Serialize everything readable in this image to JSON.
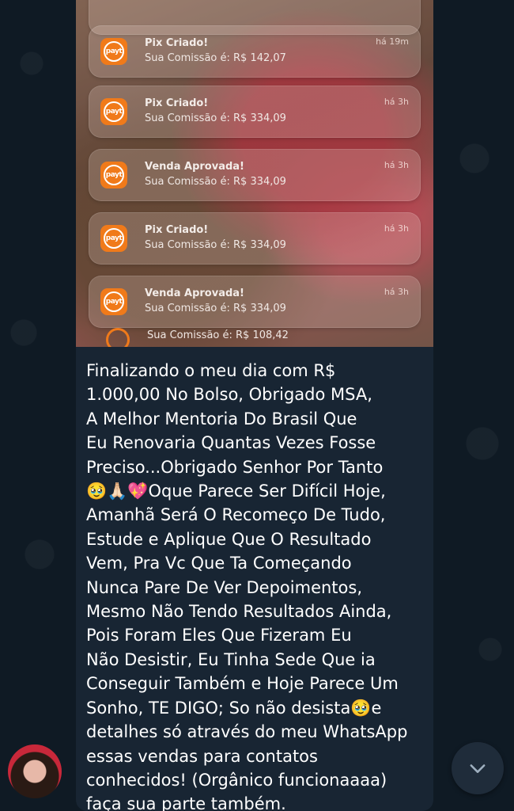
{
  "notifications": [
    {
      "title": "Pix Criado!",
      "body": "Sua Comissão é: R$ 142,07",
      "time": "há 19m"
    },
    {
      "title": "Pix Criado!",
      "body": "Sua Comissão é: R$ 334,09",
      "time": "há 3h"
    },
    {
      "title": "Venda Aprovada!",
      "body": "Sua Comissão é: R$ 334,09",
      "time": "há 3h"
    },
    {
      "title": "Pix Criado!",
      "body": "Sua Comissão é: R$ 334,09",
      "time": "há 3h"
    },
    {
      "title": "Venda Aprovada!",
      "body": "Sua Comissão é: R$ 334,09",
      "time": "há 3h"
    }
  ],
  "partial_notification": {
    "body": "Sua Comissão é: R$ 108,42"
  },
  "app_icon_text": "payt",
  "message": {
    "lines": [
      "Finalizando o meu dia com R$",
      "1.000,00 No Bolso, Obrigado MSA,",
      "A Melhor Mentoria Do Brasil Que",
      "Eu Renovaria Quantas Vezes Fosse",
      "Preciso...Obrigado Senhor Por Tanto",
      "🥹🙏🏻💖Oque Parece Ser Difícil Hoje,",
      "Amanhã Será O Recomeço De Tudo,",
      "Estude e Aplique Que O Resultado",
      "Vem, Pra Vc Que Ta Começando",
      "Nunca Pare De Ver Depoimentos,",
      "Mesmo Não Tendo Resultados Ainda,",
      "Pois Foram Eles Que Fizeram Eu",
      "Não Desistir, Eu Tinha Sede Que ia",
      "Conseguir Também e Hoje Parece Um",
      "Sonho, TE DIGO; So não desista🥹e",
      "detalhes só através do meu WhatsApp",
      "essas vendas para contatos",
      "conhecidos! (Orgânico funcionaaaa)",
      "faça sua parte também."
    ]
  },
  "colors": {
    "app_orange": "#f07a1a",
    "bubble": "#182533",
    "background": "#0e1621"
  }
}
